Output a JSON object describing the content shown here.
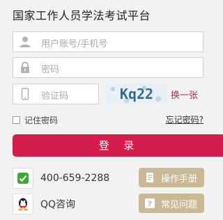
{
  "title": "国家工作人员学法考试平台",
  "username": {
    "placeholder": "用户账号/手机号",
    "icon": "user-icon"
  },
  "password": {
    "placeholder": "密码",
    "icon": "lock-icon"
  },
  "captcha": {
    "placeholder": "验证码",
    "icon": "phone-icon",
    "image_text": "Kq22",
    "refresh_label": "换一张"
  },
  "remember_label": "记住密码",
  "forgot_label": "忘记密码?",
  "login_label": "登 录",
  "contact": {
    "phone": "400-659-2288",
    "qq": "QQ咨询",
    "manual_label": "操作手册",
    "faq_label": "常见问题"
  },
  "colors": {
    "accent": "#d41d4a",
    "pill": "#c9b995"
  }
}
